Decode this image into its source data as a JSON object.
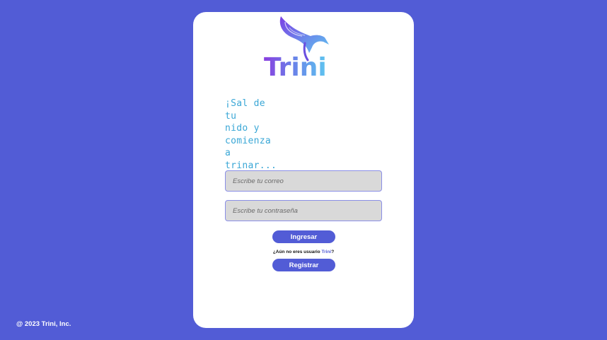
{
  "brand": {
    "logo_text": "Trini",
    "logo_icon": "bird-icon",
    "colors": {
      "primary": "#525cd6",
      "tagline": "#3aa7d6",
      "logo_gradient_start": "#7b3fe4",
      "logo_gradient_end": "#5ec5f0"
    }
  },
  "tagline": {
    "line1": "¡Sal de tu",
    "line2": "nido y",
    "line3": "comienza",
    "line4": "a trinar..."
  },
  "form": {
    "email_placeholder": "Escribe tu correo",
    "password_placeholder": "Escribe tu contraseña",
    "login_label": "Ingresar",
    "register_prompt": "¿Aún no eres usuario ",
    "register_prompt_brand": "Trini",
    "register_prompt_end": "?",
    "register_label": "Registrar"
  },
  "footer": {
    "copyright": "@ 2023 Trini, Inc."
  }
}
